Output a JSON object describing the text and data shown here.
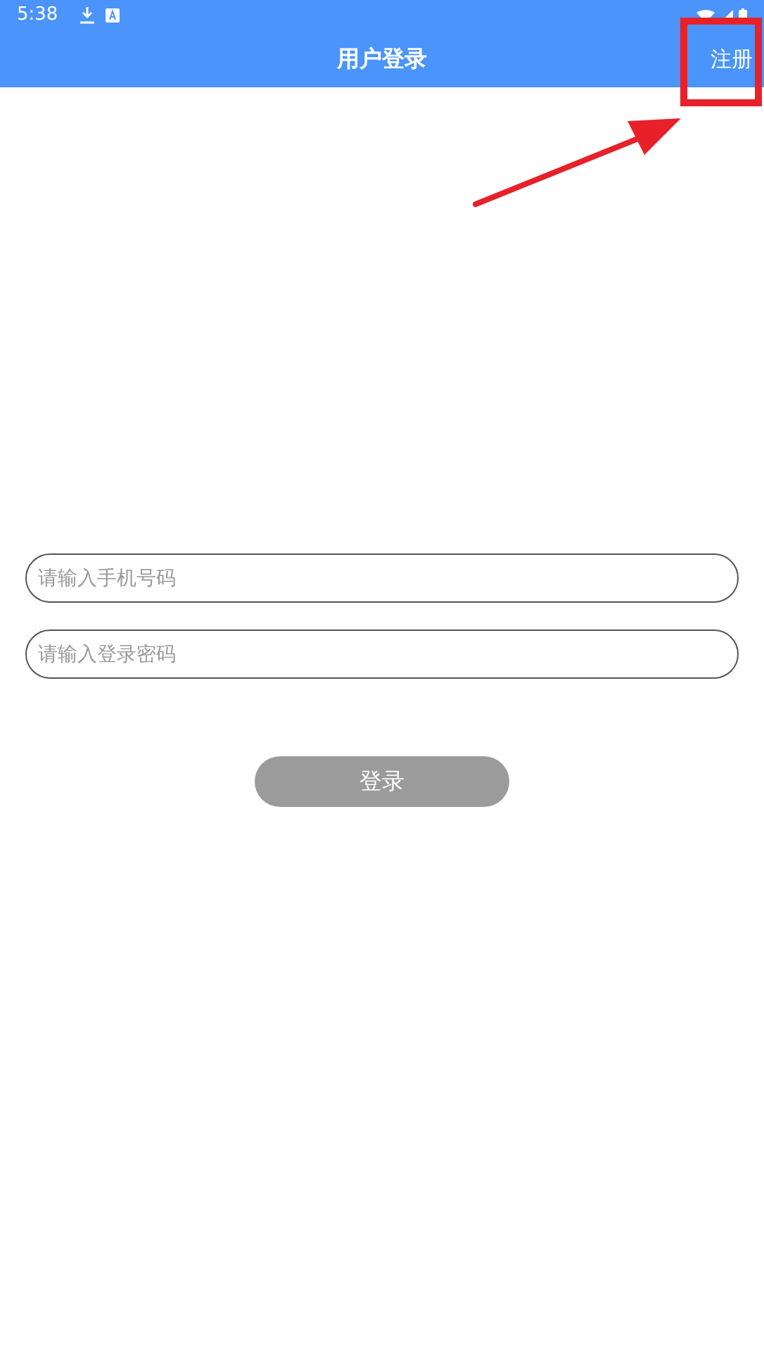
{
  "status_bar": {
    "time": "5:38"
  },
  "header": {
    "title": "用户登录",
    "action": "注册"
  },
  "fields": [
    {
      "placeholder": "请输入手机号码"
    },
    {
      "placeholder": "请输入登录密码"
    }
  ],
  "login_button": {
    "label": "登录",
    "disabled": true
  }
}
